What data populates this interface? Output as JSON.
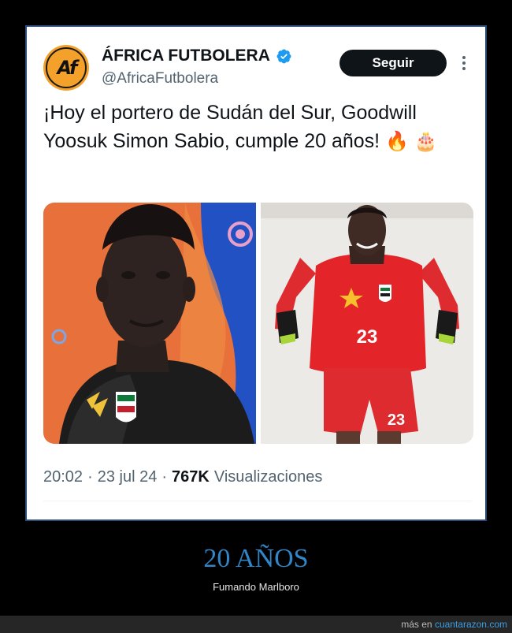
{
  "tweet": {
    "avatar_text": "Af",
    "display_name": "ÁFRICA FUTBOLERA",
    "handle": "@AfricaFutbolera",
    "follow_label": "Seguir",
    "text": "¡Hoy el portero de Sudán del Sur, Goodwill Yoosuk Simon Sabio, cumple 20 años!",
    "emojis": [
      "🔥",
      "🎂"
    ],
    "time": "20:02",
    "date": "23 jul 24",
    "separator": "·",
    "views_count": "767K",
    "views_label": "Visualizaciones",
    "jersey_number": "23"
  },
  "caption": {
    "title": "20 AÑOS",
    "subtitle": "Fumando Marlboro"
  },
  "footer": {
    "prefix": "más en",
    "site": "cuantarazon.com"
  },
  "colors": {
    "verified": "#1d9bf0",
    "caption_title": "#2f86c9",
    "link": "#3b9ee3",
    "avatar": "#f3a12a"
  }
}
